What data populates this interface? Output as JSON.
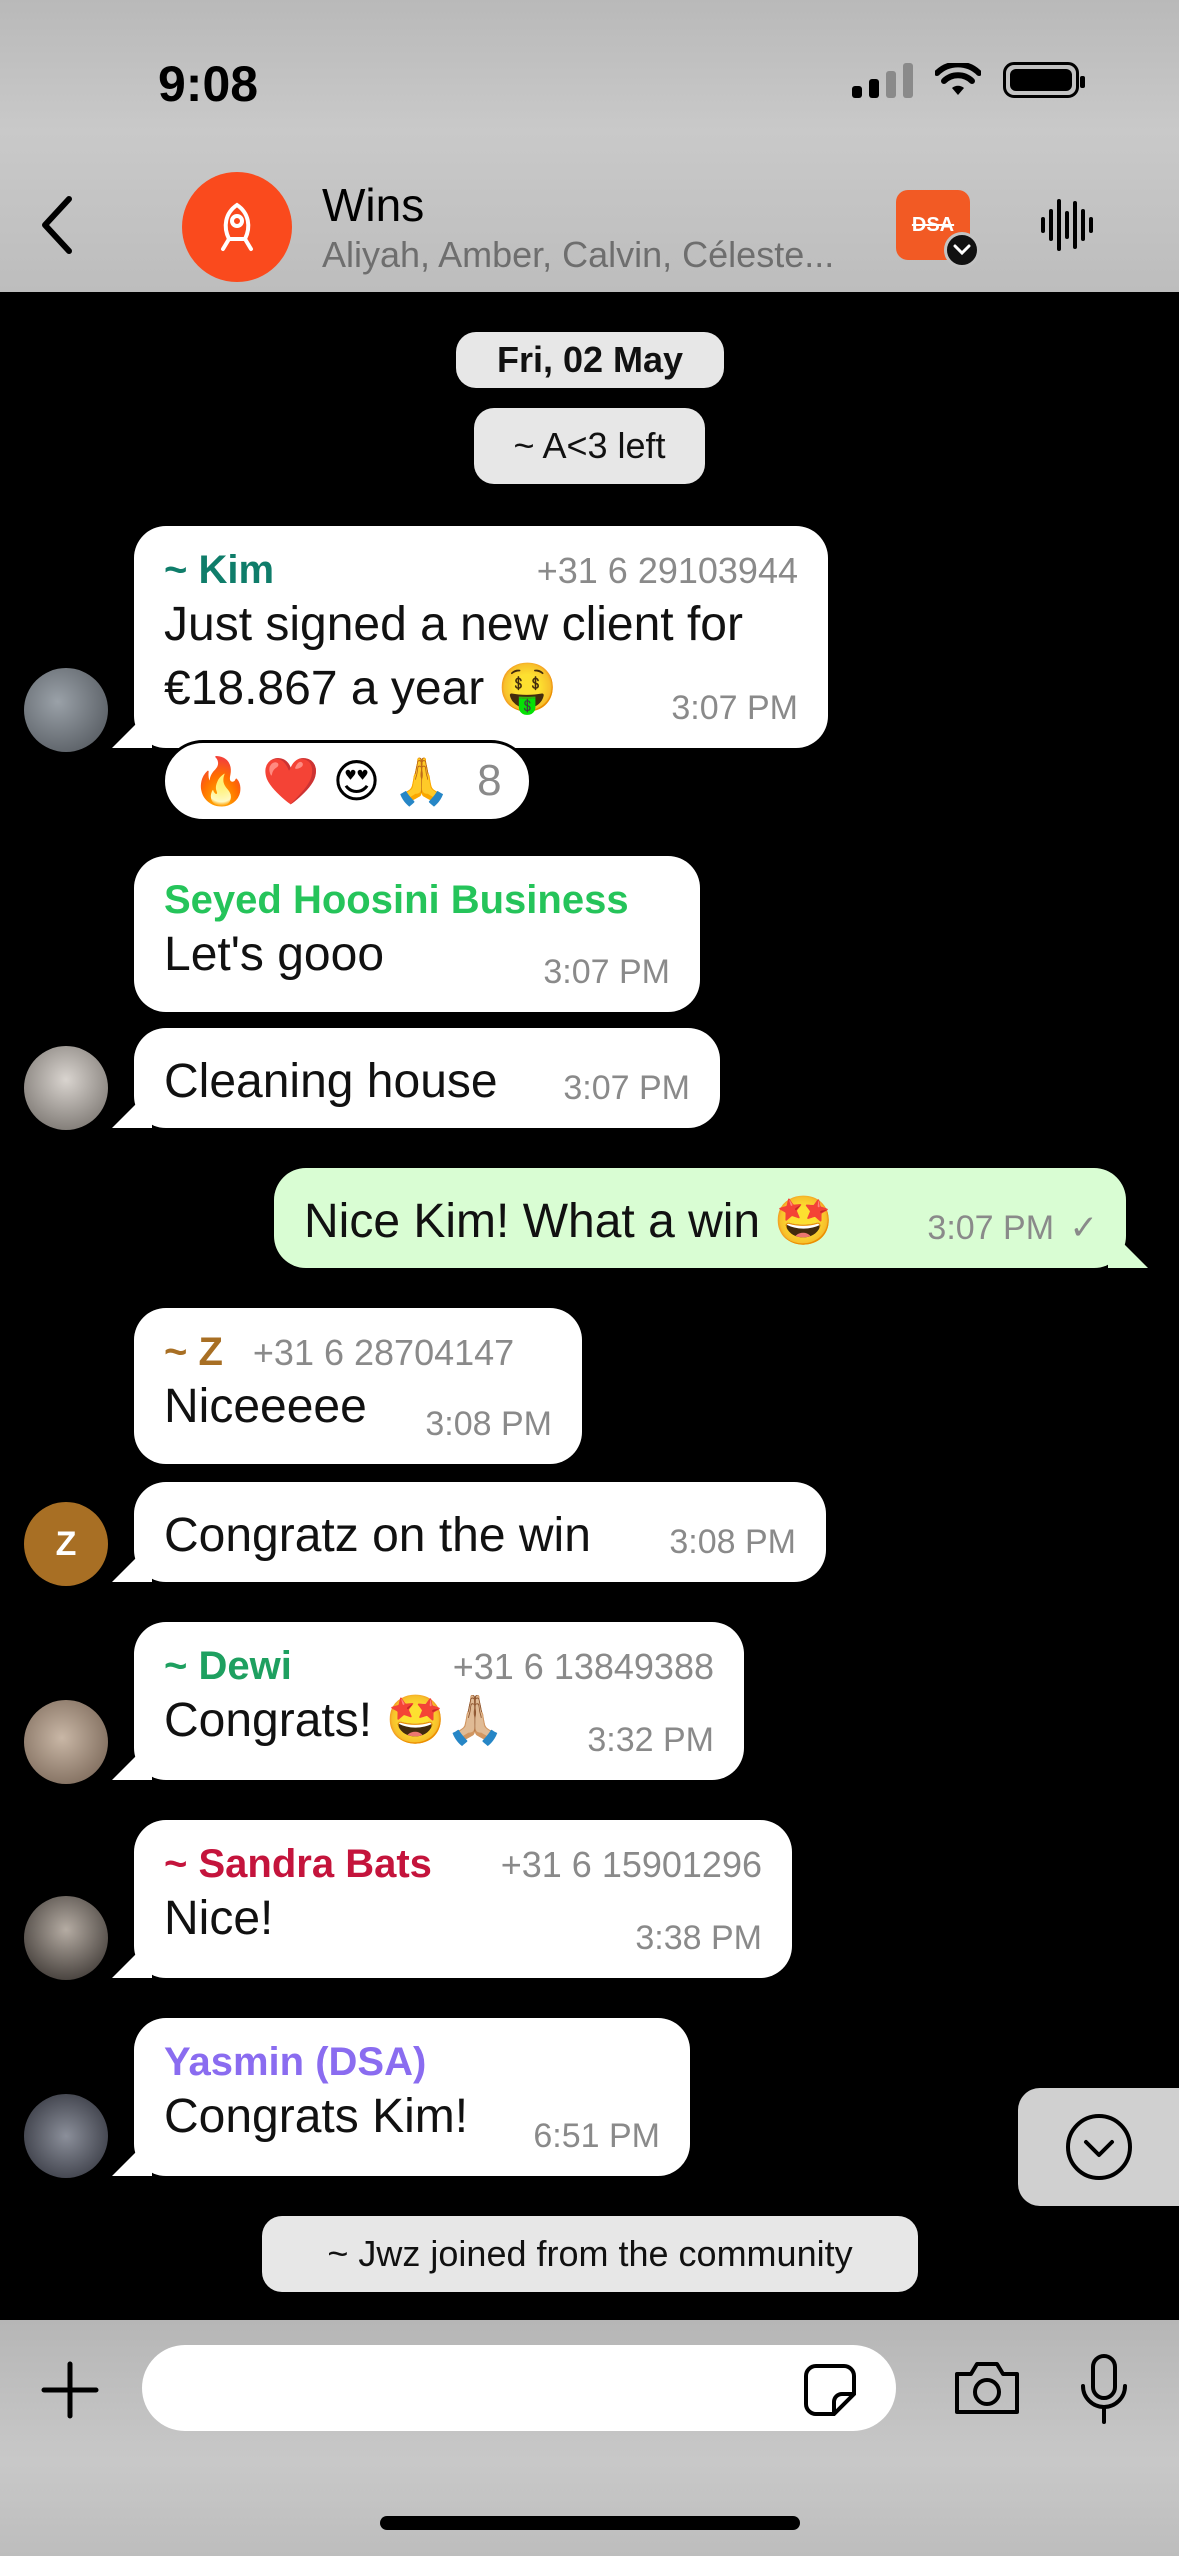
{
  "status": {
    "time": "9:08"
  },
  "header": {
    "title": "Wins",
    "subtitle": "Aliyah, Amber, Calvin, Céleste...",
    "dsa_label": "DSA"
  },
  "chat": {
    "date_pill": "Fri, 02 May",
    "system_left": "~ A<3 left",
    "messages": [
      {
        "sender": "~ Kim",
        "sender_color": "#0f7d6a",
        "phone": "+31 6 29103944",
        "text": "Just signed a new client for €18.867 a year 🤑",
        "time": "3:07 PM"
      },
      {
        "sender": "Seyed Hoosini Business",
        "sender_color": "#25c45a",
        "text": "Let's gooo",
        "time": "3:07 PM"
      },
      {
        "text": "Cleaning house",
        "time": "3:07 PM"
      },
      {
        "text": "Nice Kim! What a win 🤩",
        "time": "3:07 PM",
        "outgoing": true,
        "check": "✓"
      },
      {
        "sender": "~ Z",
        "sender_color": "#a86f24",
        "phone": "+31 6 28704147",
        "text": "Niceeeee",
        "time": "3:08 PM"
      },
      {
        "text": "Congratz on the win",
        "time": "3:08 PM"
      },
      {
        "sender": "~ Dewi",
        "sender_color": "#1ea060",
        "phone": "+31 6 13849388",
        "text": "Congrats! 🤩🙏🏼",
        "time": "3:32 PM"
      },
      {
        "sender": "~ Sandra Bats",
        "sender_color": "#c4143c",
        "phone": "+31 6 15901296",
        "text": "Nice!",
        "time": "3:38 PM"
      },
      {
        "sender": "Yasmin (DSA)",
        "sender_color": "#8a6cf0",
        "text": "Congrats Kim!",
        "time": "6:51 PM"
      }
    ],
    "reactions": {
      "emojis": "🔥 ❤️ 😍 🙏",
      "count": "8"
    },
    "z_avatar_letter": "Z",
    "system_joined": "~ Jwz joined from the community"
  },
  "composer": {
    "placeholder": ""
  },
  "colors": {
    "outgoing_bubble": "#d9fdd3",
    "accent_orange": "#fa4a1d"
  }
}
